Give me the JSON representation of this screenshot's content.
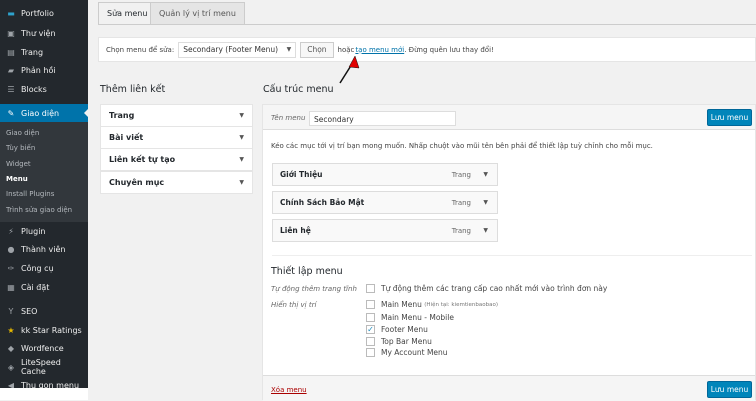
{
  "sidebar": {
    "items": [
      {
        "label": "Portfolio",
        "icon": "folder-icon"
      },
      {
        "label": "Thư viện",
        "icon": "media-icon"
      },
      {
        "label": "Trang",
        "icon": "page-icon"
      },
      {
        "label": "Phản hồi",
        "icon": "comment-icon"
      },
      {
        "label": "Blocks",
        "icon": "blocks-icon"
      },
      {
        "label": "Giao diện",
        "icon": "brush-icon",
        "active": true
      },
      {
        "label": "Plugin",
        "icon": "plugin-icon"
      },
      {
        "label": "Thành viên",
        "icon": "user-icon"
      },
      {
        "label": "Công cụ",
        "icon": "wrench-icon"
      },
      {
        "label": "Cài đặt",
        "icon": "settings-icon"
      },
      {
        "label": "SEO",
        "icon": "yoast-icon"
      },
      {
        "label": "kk Star Ratings",
        "icon": "star-icon"
      },
      {
        "label": "Wordfence",
        "icon": "shield-icon"
      },
      {
        "label": "LiteSpeed Cache",
        "icon": "diamond-icon"
      },
      {
        "label": "Thu gọn menu",
        "icon": "collapse-icon"
      }
    ],
    "submenu": [
      "Giao diện",
      "Tùy biến",
      "Widget",
      "Menu",
      "Install Plugins",
      "Trình sửa giao diện"
    ]
  },
  "tabs": [
    "Sửa menu",
    "Quản lý vị trí menu"
  ],
  "select_bar": {
    "label": "Chọn menu để sửa:",
    "selected": "Secondary (Footer Menu)",
    "button": "Chọn",
    "or": "hoặc",
    "link": "tạo menu mới",
    "after": ". Đừng quên lưu thay đổi!"
  },
  "add_links": {
    "title": "Thêm liên kết",
    "sections": [
      "Trang",
      "Bài viết",
      "Liên kết tự tạo",
      "Chuyên mục"
    ]
  },
  "structure": {
    "title": "Cấu trúc menu",
    "name_label": "Tên menu",
    "name_value": "Secondary",
    "save": "Lưu menu",
    "hint": "Kéo các mục tới vị trí bạn mong muốn. Nhấp chuột vào mũi tên bên phải để thiết lập tuỳ chỉnh cho mỗi mục.",
    "items": [
      {
        "title": "Giới Thiệu",
        "type": "Trang"
      },
      {
        "title": "Chính Sách Bảo Mật",
        "type": "Trang"
      },
      {
        "title": "Liên hệ",
        "type": "Trang"
      }
    ]
  },
  "settings": {
    "title": "Thiết lập menu",
    "auto_label": "Tự động thêm trang tĩnh",
    "auto_option": "Tự động thêm các trang cấp cao nhất mới vào trình đơn này",
    "locations_label": "Hiển thị vị trí",
    "locations": [
      {
        "label": "Main Menu",
        "note": "(Hiện tại: kiemtienbaobao)",
        "checked": false
      },
      {
        "label": "Main Menu - Mobile",
        "checked": false
      },
      {
        "label": "Footer Menu",
        "checked": true
      },
      {
        "label": "Top Bar Menu",
        "checked": false
      },
      {
        "label": "My Account Menu",
        "checked": false
      }
    ]
  },
  "footer": {
    "delete": "Xóa menu",
    "save": "Lưu menu"
  },
  "colors": {
    "sidebar": "#23282d",
    "accent": "#0073aa",
    "button": "#0085ba",
    "annotation_arrow": "#e00000"
  }
}
